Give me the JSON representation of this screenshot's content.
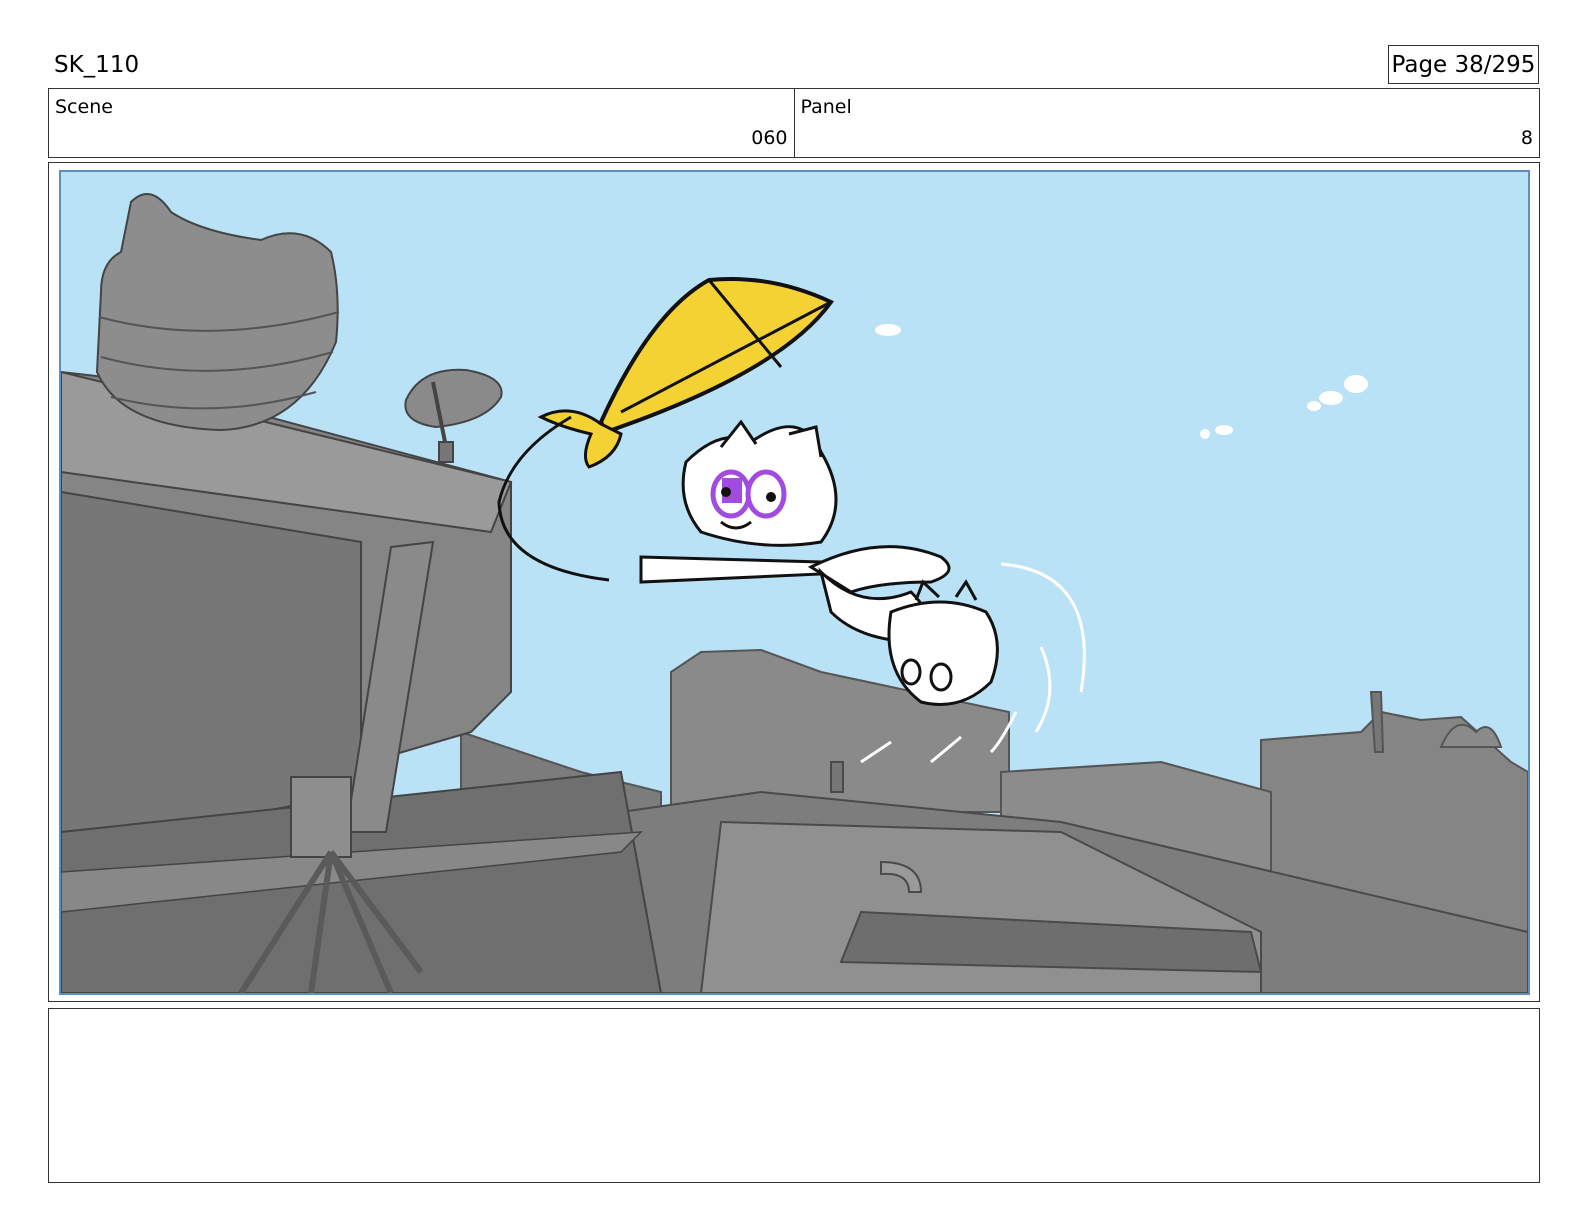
{
  "header": {
    "project": "SK_110",
    "page": "Page  38/295"
  },
  "scene": {
    "label": "Scene",
    "value": "060"
  },
  "panel": {
    "label": "Panel",
    "value": "8"
  },
  "colors": {
    "sky": "#b9e2f7",
    "buildings": "#7a7a7a",
    "kite": "#f5d233",
    "accent": "#a24be0"
  },
  "notes": {
    "text": ""
  }
}
